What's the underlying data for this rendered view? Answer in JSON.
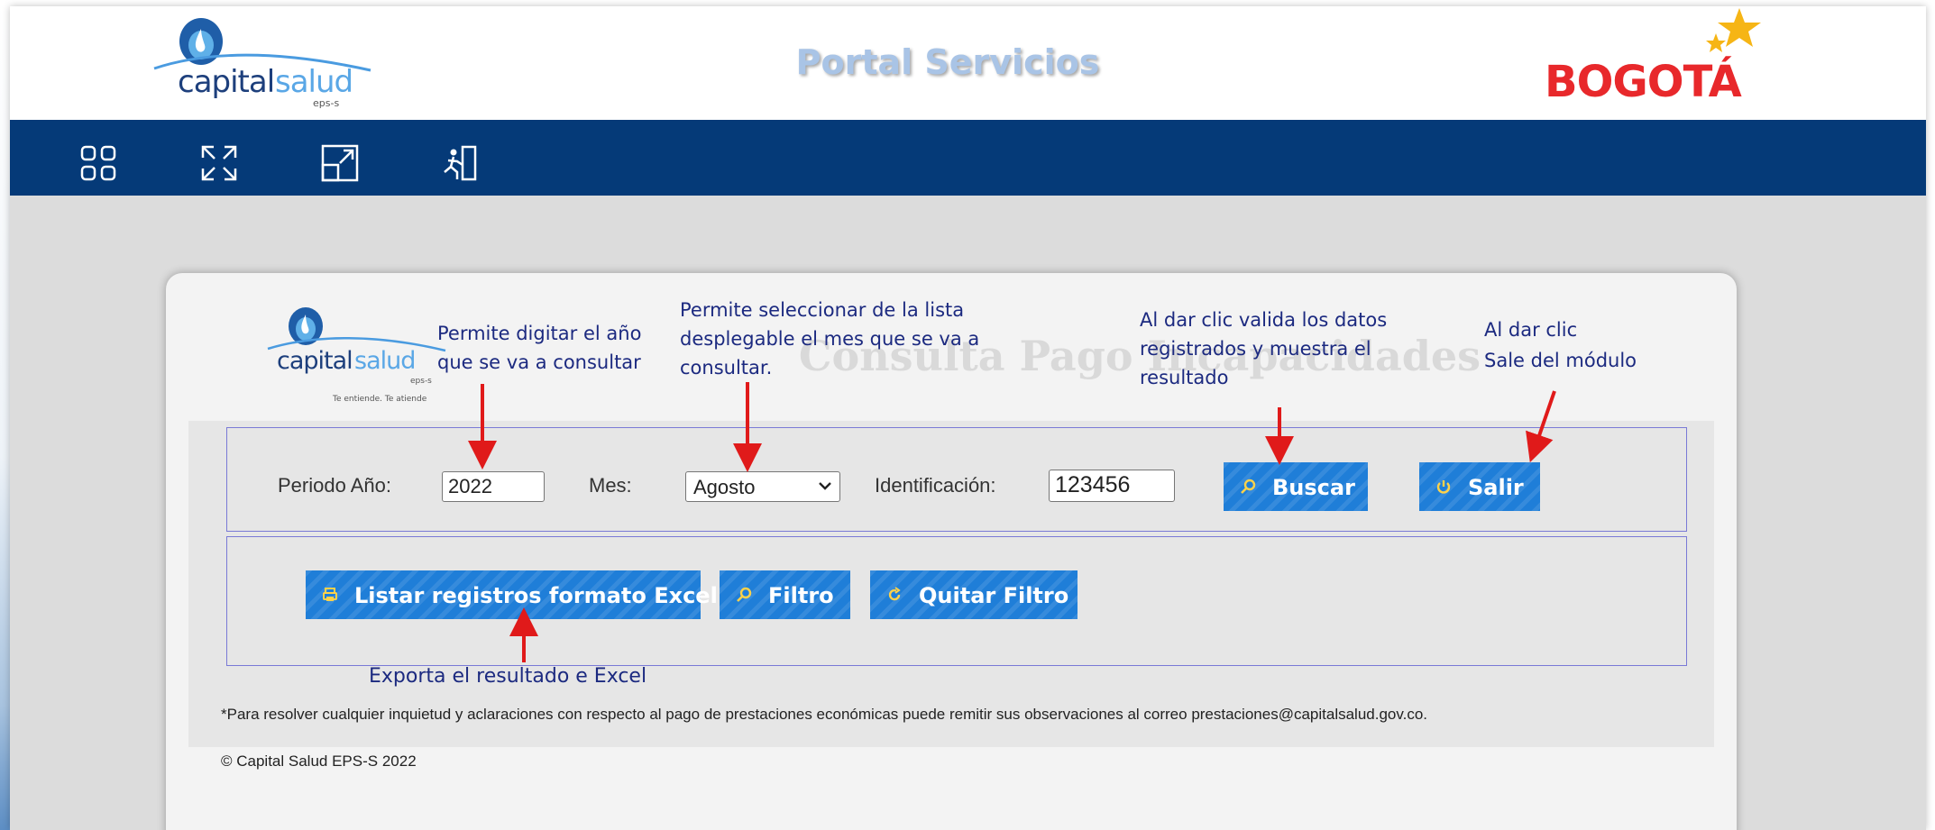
{
  "header": {
    "title": "Portal Servicios",
    "logo_main": "capitalsalud",
    "logo_sub": "eps-s",
    "partner_logo": "BOGOTÁ"
  },
  "nav": {
    "icons": [
      "grid-icon",
      "fullscreen-icon",
      "open-window-icon",
      "logout-icon"
    ]
  },
  "panel": {
    "logo_main": "capitalsalud",
    "logo_sub": "eps-s",
    "logo_tagline": "Te entiende. Te atiende",
    "heading": "Consulta Pago Incapacidades"
  },
  "form": {
    "year_label": "Periodo Año:",
    "year_value": "2022",
    "month_label": "Mes:",
    "month_value": "Agosto",
    "id_label": "Identificación:",
    "id_value": "123456",
    "search_button": "Buscar",
    "exit_button": "Salir"
  },
  "actions": {
    "excel_button": "Listar registros formato Excel",
    "filter_button": "Filtro",
    "clear_filter_button": "Quitar Filtro"
  },
  "footer": {
    "note": "*Para resolver cualquier inquietud y aclaraciones con respecto al pago de prestaciones económicas puede remitir sus observaciones al correo prestaciones@capitalsalud.gov.co.",
    "copyright": "© Capital Salud EPS-S 2022"
  },
  "annotations": {
    "year": "Permite digitar el año que se va a consultar",
    "month": "Permite seleccionar de la lista desplegable el mes que se va a consultar.",
    "search": "Al dar clic valida los datos registrados y muestra el resultado",
    "exit_line1": "Al  dar clic",
    "exit_line2": "Sale del módulo",
    "excel": "Exporta el resultado e Excel"
  },
  "colors": {
    "navbar": "#053a78",
    "button": "#1f7ed8",
    "annotation_text": "#1c2a80",
    "arrow": "#e01a1a",
    "brand_red": "#e8282b"
  }
}
